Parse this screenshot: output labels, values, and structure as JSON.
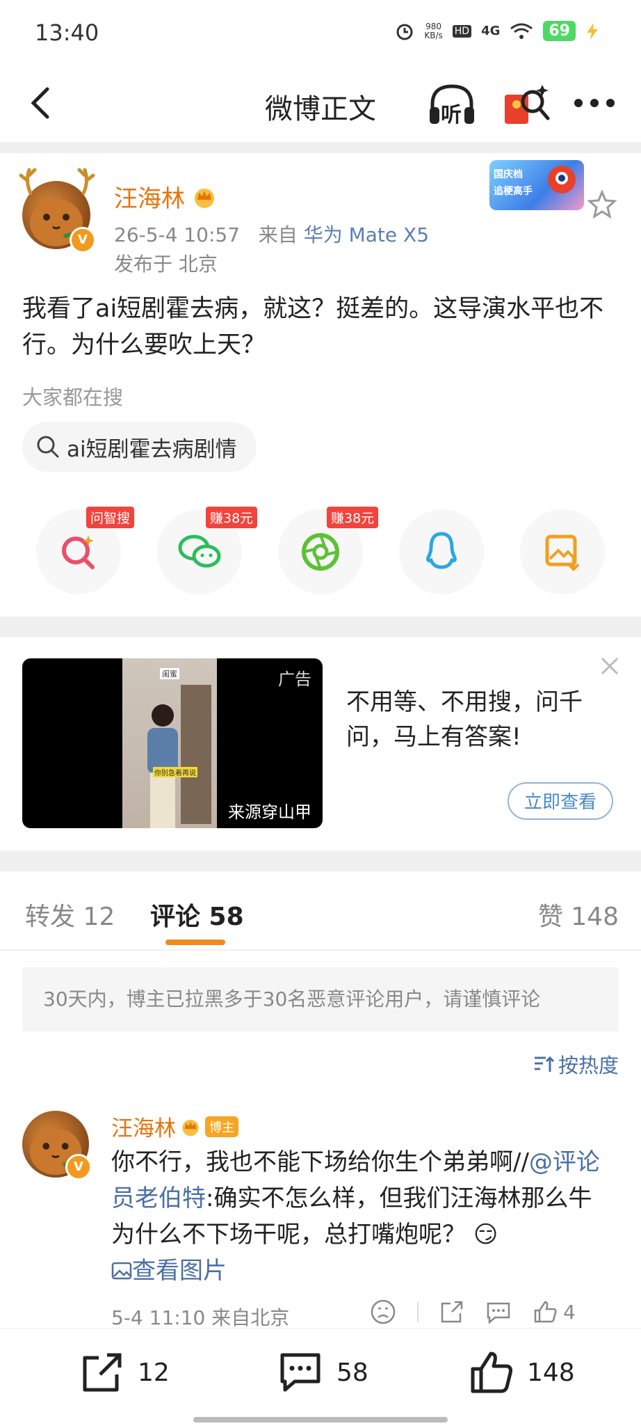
{
  "status_bar": {
    "time": "13:40",
    "net_speed_value": "980",
    "net_speed_unit": "KB/s",
    "hd": "HD",
    "signal": "4G",
    "battery": "69"
  },
  "nav": {
    "title": "微博正文",
    "listen_label": "听"
  },
  "post": {
    "author": "汪海林",
    "date": "26-5-4 10:57",
    "source_prefix": "来自",
    "source_device": "华为 Mate X5",
    "location": "发布于 北京",
    "text": "我看了ai短剧霍去病，就这？挺差的。这导演水平也不行。为什么要吹上天？",
    "search_label": "大家都在搜",
    "search_chip": "ai短剧霍去病剧情",
    "event_badge_line1": "国庆档",
    "event_badge_line2": "追梗高手",
    "share_items": [
      {
        "name": "ask-ai-search",
        "tag": "问智搜",
        "icon": "search-spark-icon",
        "color": "#e8506a"
      },
      {
        "name": "wechat",
        "tag": "赚38元",
        "icon": "wechat-icon",
        "color": "#2bbd5a"
      },
      {
        "name": "moments",
        "tag": "赚38元",
        "icon": "moments-icon",
        "color": "#5bc236"
      },
      {
        "name": "qq",
        "tag": "",
        "icon": "qq-icon",
        "color": "#2aa7e6"
      },
      {
        "name": "save-image",
        "tag": "",
        "icon": "save-image-icon",
        "color": "#f0a020"
      }
    ]
  },
  "ad": {
    "label": "广告",
    "source": "来源穿山甲",
    "thumb_tag": "闺蜜",
    "thumb_caption": "你别急着再说",
    "text": "不用等、不用搜，问千问，马上有答案!",
    "button": "立即查看"
  },
  "tabs": {
    "repost": "转发 12",
    "comment": "评论 58",
    "like": "赞 148"
  },
  "notice": "30天内，博主已拉黑多于30名恶意评论用户，请谨慎评论",
  "sort_label": "按热度",
  "comment": {
    "author": "汪海林",
    "host_badge": "博主",
    "text_part1": "你不行，我也不能下场给你生个弟弟啊//",
    "mention": "@评论员老伯特",
    "text_part2": ":确实不怎么样，但我们汪海林那么牛为什么不下场干呢，总打嘴炮呢？",
    "emoji": "😏",
    "view_image": "查看图片",
    "meta": "5-4 11:10  来自北京",
    "like_count": "4"
  },
  "bottom_bar": {
    "repost_count": "12",
    "comment_count": "58",
    "like_count": "148"
  }
}
